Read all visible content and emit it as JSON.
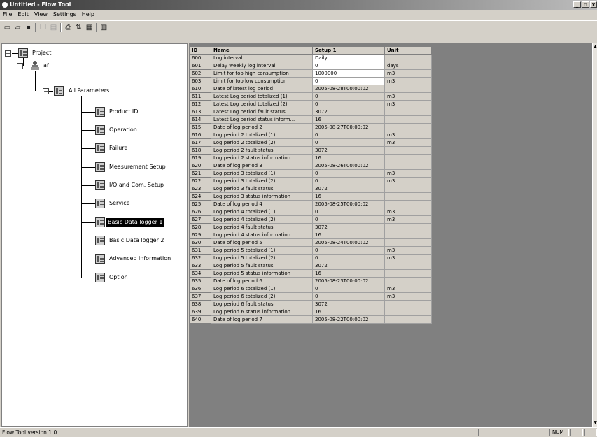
{
  "window": {
    "title": "Untitled - Flow Tool"
  },
  "menu": [
    "File",
    "Edit",
    "View",
    "Settings",
    "Help"
  ],
  "toolbar": {
    "icons": [
      "new-file-icon",
      "open-folder-icon",
      "save-icon",
      "copy-icon",
      "paste-icon",
      "print-icon",
      "sort-icon",
      "grid-icon",
      "columns-icon"
    ]
  },
  "tree": {
    "root": "Project",
    "device": "af",
    "group": "All Parameters",
    "items": [
      {
        "label": "Product ID",
        "selected": false
      },
      {
        "label": "Operation",
        "selected": false
      },
      {
        "label": "Failure",
        "selected": false
      },
      {
        "label": "Measurement Setup",
        "selected": false
      },
      {
        "label": "I/O and Com. Setup",
        "selected": false
      },
      {
        "label": "Service",
        "selected": false
      },
      {
        "label": "Basic Data logger 1",
        "selected": true
      },
      {
        "label": "Basic Data logger 2",
        "selected": false
      },
      {
        "label": "Advanced information",
        "selected": false
      },
      {
        "label": "Option",
        "selected": false
      }
    ]
  },
  "table": {
    "columns": [
      "ID",
      "Name",
      "Setup 1",
      "Unit"
    ],
    "rows": [
      {
        "id": "600",
        "name": "Log interval",
        "setup": "Daily",
        "unit": "",
        "editable": true
      },
      {
        "id": "601",
        "name": "Delay weekly log interval",
        "setup": "0",
        "unit": "days",
        "editable": true
      },
      {
        "id": "602",
        "name": "Limit for too high consumption",
        "setup": "1000000",
        "unit": "m3",
        "editable": true
      },
      {
        "id": "603",
        "name": "Limit for too low consumption",
        "setup": "0",
        "unit": "m3",
        "editable": true
      },
      {
        "id": "610",
        "name": "Date of latest log period",
        "setup": "2005-08-28T00:00:02",
        "unit": "",
        "editable": false
      },
      {
        "id": "611",
        "name": "Latest Log period totalized (1)",
        "setup": "0",
        "unit": "m3",
        "editable": false
      },
      {
        "id": "612",
        "name": "Latest Log period totalized (2)",
        "setup": "0",
        "unit": "m3",
        "editable": false
      },
      {
        "id": "613",
        "name": "Latest Log period fault status",
        "setup": "3072",
        "unit": "",
        "editable": false
      },
      {
        "id": "614",
        "name": "Latest Log period status inform...",
        "setup": "16",
        "unit": "",
        "editable": false
      },
      {
        "id": "615",
        "name": "Date of log period 2",
        "setup": "2005-08-27T00:00:02",
        "unit": "",
        "editable": false
      },
      {
        "id": "616",
        "name": "Log period 2 totalized (1)",
        "setup": "0",
        "unit": "m3",
        "editable": false
      },
      {
        "id": "617",
        "name": "Log period 2 totalized (2)",
        "setup": "0",
        "unit": "m3",
        "editable": false
      },
      {
        "id": "618",
        "name": "Log period 2 fault status",
        "setup": "3072",
        "unit": "",
        "editable": false
      },
      {
        "id": "619",
        "name": "Log period 2 status information",
        "setup": "16",
        "unit": "",
        "editable": false
      },
      {
        "id": "620",
        "name": "Date of log period 3",
        "setup": "2005-08-26T00:00:02",
        "unit": "",
        "editable": false
      },
      {
        "id": "621",
        "name": "Log period 3 totalized (1)",
        "setup": "0",
        "unit": "m3",
        "editable": false
      },
      {
        "id": "622",
        "name": "Log period 3 totalized (2)",
        "setup": "0",
        "unit": "m3",
        "editable": false
      },
      {
        "id": "623",
        "name": "Log period 3 fault status",
        "setup": "3072",
        "unit": "",
        "editable": false
      },
      {
        "id": "624",
        "name": "Log period 3 status information",
        "setup": "16",
        "unit": "",
        "editable": false
      },
      {
        "id": "625",
        "name": "Date of log period 4",
        "setup": "2005-08-25T00:00:02",
        "unit": "",
        "editable": false
      },
      {
        "id": "626",
        "name": "Log period 4 totalized (1)",
        "setup": "0",
        "unit": "m3",
        "editable": false
      },
      {
        "id": "627",
        "name": "Log period 4 totalized (2)",
        "setup": "0",
        "unit": "m3",
        "editable": false
      },
      {
        "id": "628",
        "name": "Log period 4 fault status",
        "setup": "3072",
        "unit": "",
        "editable": false
      },
      {
        "id": "629",
        "name": "Log period 4 status information",
        "setup": "16",
        "unit": "",
        "editable": false
      },
      {
        "id": "630",
        "name": "Date of log period 5",
        "setup": "2005-08-24T00:00:02",
        "unit": "",
        "editable": false
      },
      {
        "id": "631",
        "name": "Log period 5 totalized (1)",
        "setup": "0",
        "unit": "m3",
        "editable": false
      },
      {
        "id": "632",
        "name": "Log period 5 totalized (2)",
        "setup": "0",
        "unit": "m3",
        "editable": false
      },
      {
        "id": "633",
        "name": "Log period 5 fault status",
        "setup": "3072",
        "unit": "",
        "editable": false
      },
      {
        "id": "634",
        "name": "Log period 5 status information",
        "setup": "16",
        "unit": "",
        "editable": false
      },
      {
        "id": "635",
        "name": "Date of log period 6",
        "setup": "2005-08-23T00:00:02",
        "unit": "",
        "editable": false
      },
      {
        "id": "636",
        "name": "Log period 6 totalized (1)",
        "setup": "0",
        "unit": "m3",
        "editable": false
      },
      {
        "id": "637",
        "name": "Log period 6 totalized (2)",
        "setup": "0",
        "unit": "m3",
        "editable": false
      },
      {
        "id": "638",
        "name": "Log period 6 fault status",
        "setup": "3072",
        "unit": "",
        "editable": false
      },
      {
        "id": "639",
        "name": "Log period 6 status information",
        "setup": "16",
        "unit": "",
        "editable": false
      },
      {
        "id": "640",
        "name": "Date of log period 7",
        "setup": "2005-08-22T00:00:02",
        "unit": "",
        "editable": false
      }
    ]
  },
  "status": {
    "text": "Flow Tool version 1.0",
    "num": "NUM"
  }
}
